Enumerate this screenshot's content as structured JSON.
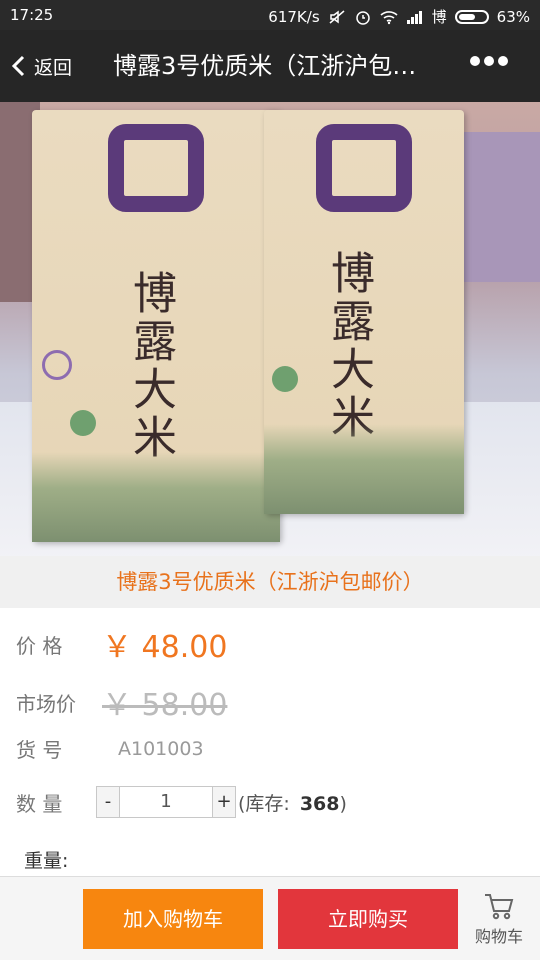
{
  "status_bar": {
    "time": "17:25",
    "speed": "617K/s",
    "carrier": "博",
    "battery": "63%",
    "battery_level": 0.63,
    "icons": [
      "mute-icon",
      "alarm-icon",
      "wifi-icon",
      "signal-icon",
      "battery-icon"
    ]
  },
  "nav": {
    "back_label": "返回",
    "title": "博露3号优质米（江浙沪包邮价）",
    "more_icon": "more-dots-icon"
  },
  "hero": {
    "bag_brand": "博露大米",
    "carousel_count": 3,
    "carousel_active": 1
  },
  "product": {
    "name": "博露3号优质米（江浙沪包邮价）",
    "price_label": "价 格",
    "price": "￥ 48.00",
    "market_label": "市场价",
    "market_price": "￥ 58.00",
    "sku_label": "货 号",
    "sku": "A101003",
    "qty_label": "数 量",
    "qty_minus": "-",
    "qty_value": "1",
    "qty_plus": "+",
    "stock_prefix": "(库存:",
    "stock": "368",
    "stock_suffix": ")",
    "weight_label": "重量:"
  },
  "bottom_bar": {
    "add_to_cart": "加入购物车",
    "buy_now": "立即购买",
    "cart": "购物车"
  },
  "colors": {
    "accent_orange": "#f07620",
    "cart_button": "#f7860f",
    "buy_button": "#e2363c",
    "navbar": "#262626"
  }
}
